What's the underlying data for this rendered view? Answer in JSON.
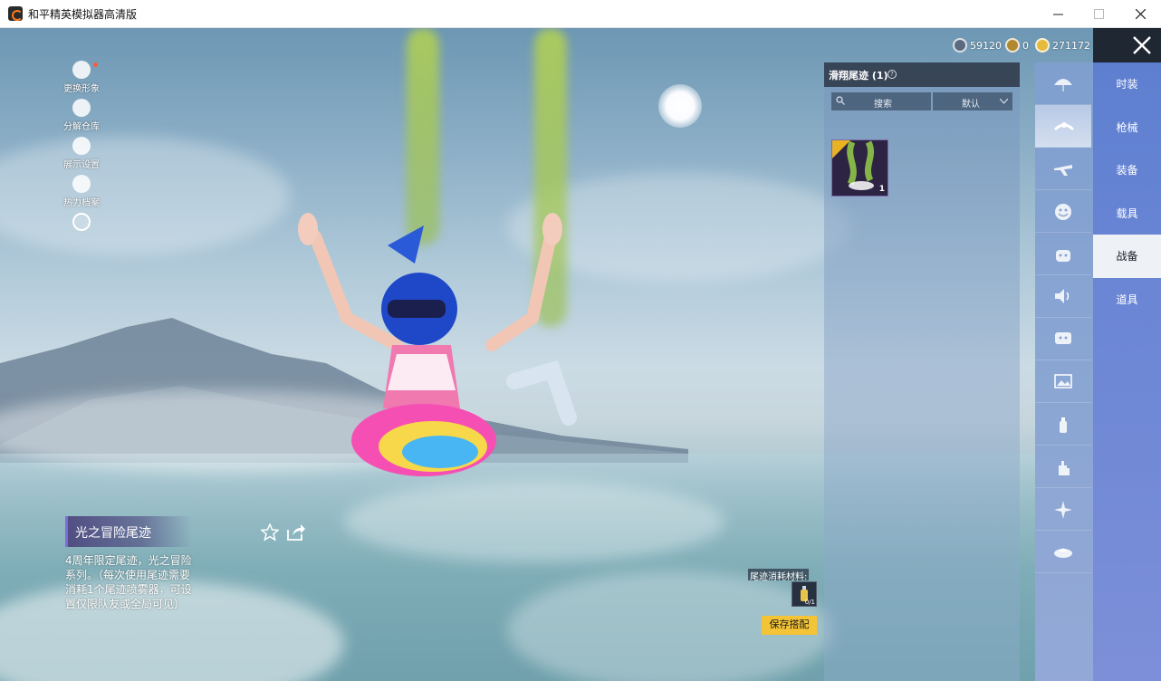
{
  "window": {
    "title": "和平精英模拟器高清版",
    "controls": [
      "minimize",
      "maximize",
      "close"
    ]
  },
  "left_menu": {
    "items": [
      {
        "label": "更换形象",
        "icon": "avatar-icon",
        "has_notification": true
      },
      {
        "label": "分解仓库",
        "icon": "gear-icon"
      },
      {
        "label": "展示设置",
        "icon": "eye-icon"
      },
      {
        "label": "热力档案",
        "icon": "flame-icon"
      },
      {
        "label": "",
        "icon": "add-icon"
      }
    ]
  },
  "currency": [
    {
      "icon": "silver-coin-icon",
      "value": "59120"
    },
    {
      "icon": "medal-coin-icon",
      "value": "0"
    },
    {
      "icon": "gold-coin-icon",
      "value": "271172"
    }
  ],
  "panel": {
    "title": "滑翔尾迹 (1)",
    "search_placeholder": "搜索",
    "sort_label": "默认",
    "items": [
      {
        "name": "光之冒险尾迹",
        "count": "1",
        "equipped": true
      }
    ]
  },
  "rail": {
    "icons": [
      "parachute-icon",
      "trail-icon",
      "plane-icon",
      "emote-icon",
      "robot-icon",
      "voice-icon",
      "chat-icon",
      "gallery-icon",
      "spray-icon",
      "hand-icon",
      "sparkle-icon",
      "vehicle-icon"
    ],
    "active_index": 1
  },
  "tabs": {
    "items": [
      "时装",
      "枪械",
      "装备",
      "载具",
      "战备",
      "道具"
    ],
    "active_index": 4
  },
  "detail": {
    "name": "光之冒险尾迹",
    "description": "4周年限定尾迹，光之冒险系列。（每次使用尾迹需要消耗1个尾迹喷雾器，可设置仅限队友或全局可见）"
  },
  "materials": {
    "label": "尾迹消耗材料:",
    "count": "0/1"
  },
  "save_button": "保存搭配",
  "colors": {
    "tab_bar": "#6a86d4",
    "active_tab": "#eef1f6",
    "save_button": "#f4c437",
    "accent_purple": "#7f6cd8"
  }
}
